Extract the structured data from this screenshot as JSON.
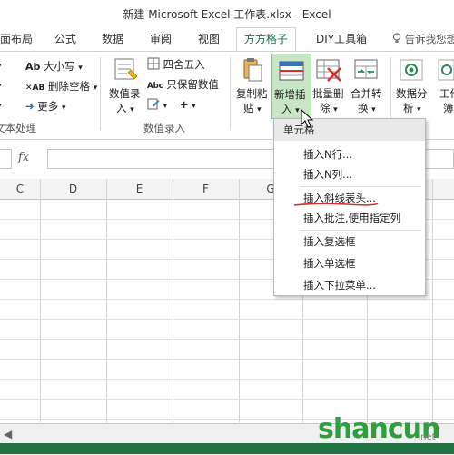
{
  "window": {
    "title": "新建 Microsoft Excel 工作表.xlsx - Excel"
  },
  "tabs": [
    {
      "label": "页面布局"
    },
    {
      "label": "公式"
    },
    {
      "label": "数据"
    },
    {
      "label": "审阅"
    },
    {
      "label": "视图"
    },
    {
      "label": "方方格子",
      "active": true
    },
    {
      "label": "DIY工具箱"
    }
  ],
  "tell_me": "告诉我您想",
  "ribbon": {
    "text_group": {
      "case_label": "大小写",
      "remove_space_label": "删除空格",
      "more_label": "更多",
      "group_label": "文本处理"
    },
    "entry_group": {
      "data_entry_line1": "数值录",
      "data_entry_line2": "入",
      "round_label": "四舍五入",
      "keep_value_label": "只保留数值",
      "group_label": "数值录入"
    },
    "copy_paste_line1": "复制粘",
    "copy_paste_line2": "贴",
    "new_insert_line1": "新增插",
    "new_insert_line2": "入",
    "batch_delete_line1": "批量删",
    "batch_delete_line2": "除",
    "merge_convert_line1": "合并转",
    "merge_convert_line2": "换",
    "data_analysis_line1": "数据分",
    "data_analysis_line2": "析",
    "work_line1": "工作",
    "work_line2": "簿"
  },
  "formula_bar": {
    "fx": "fx",
    "value": ""
  },
  "columns": [
    "C",
    "D",
    "E",
    "F",
    "G"
  ],
  "dropdown": {
    "header": "单元格",
    "items": [
      "插入N行...",
      "插入N列...",
      "插入斜线表头...",
      "插入批注,使用指定列",
      "插入复选框",
      "插入单选框",
      "插入下拉菜单..."
    ]
  },
  "watermark": {
    "logo": "shancun",
    "sub": ".net"
  },
  "colors": {
    "accent": "#217346",
    "highlight": "#cfe8cf",
    "underline_red": "#d9302b"
  }
}
